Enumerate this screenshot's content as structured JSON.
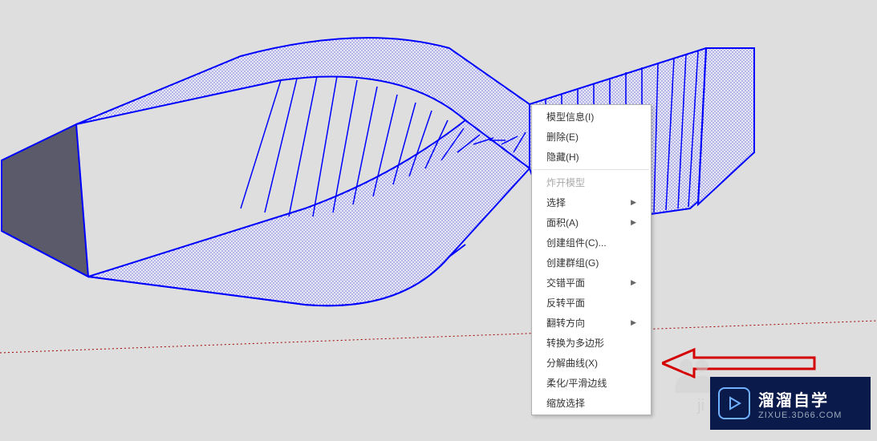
{
  "contextMenu": {
    "items": [
      {
        "label": "模型信息(I)",
        "enabled": true,
        "submenu": false
      },
      {
        "label": "删除(E)",
        "enabled": true,
        "submenu": false
      },
      {
        "label": "隐藏(H)",
        "enabled": true,
        "submenu": false
      },
      {
        "divider": true
      },
      {
        "label": "炸开模型",
        "enabled": false,
        "submenu": false
      },
      {
        "label": "选择",
        "enabled": true,
        "submenu": true
      },
      {
        "label": "面积(A)",
        "enabled": true,
        "submenu": true
      },
      {
        "label": "创建组件(C)...",
        "enabled": true,
        "submenu": false
      },
      {
        "label": "创建群组(G)",
        "enabled": true,
        "submenu": false
      },
      {
        "label": "交错平面",
        "enabled": true,
        "submenu": true
      },
      {
        "label": "反转平面",
        "enabled": true,
        "submenu": false
      },
      {
        "label": "翻转方向",
        "enabled": true,
        "submenu": true
      },
      {
        "label": "转换为多边形",
        "enabled": true,
        "submenu": false
      },
      {
        "label": "分解曲线(X)",
        "enabled": true,
        "submenu": false
      },
      {
        "label": "柔化/平滑边线",
        "enabled": true,
        "submenu": false
      },
      {
        "label": "缩放选择",
        "enabled": true,
        "submenu": false
      }
    ]
  },
  "watermark": {
    "title": "溜溜自学",
    "url": "ZIXUE.3D66.COM",
    "ghostText": "ji"
  },
  "annotation": {
    "arrowColor": "#d40000"
  },
  "model": {
    "edgeColor": "#0000ff",
    "faceFillPattern": "dotted-blue",
    "axisColorX": "#a00000",
    "axisColorZ": "#0000d0"
  }
}
